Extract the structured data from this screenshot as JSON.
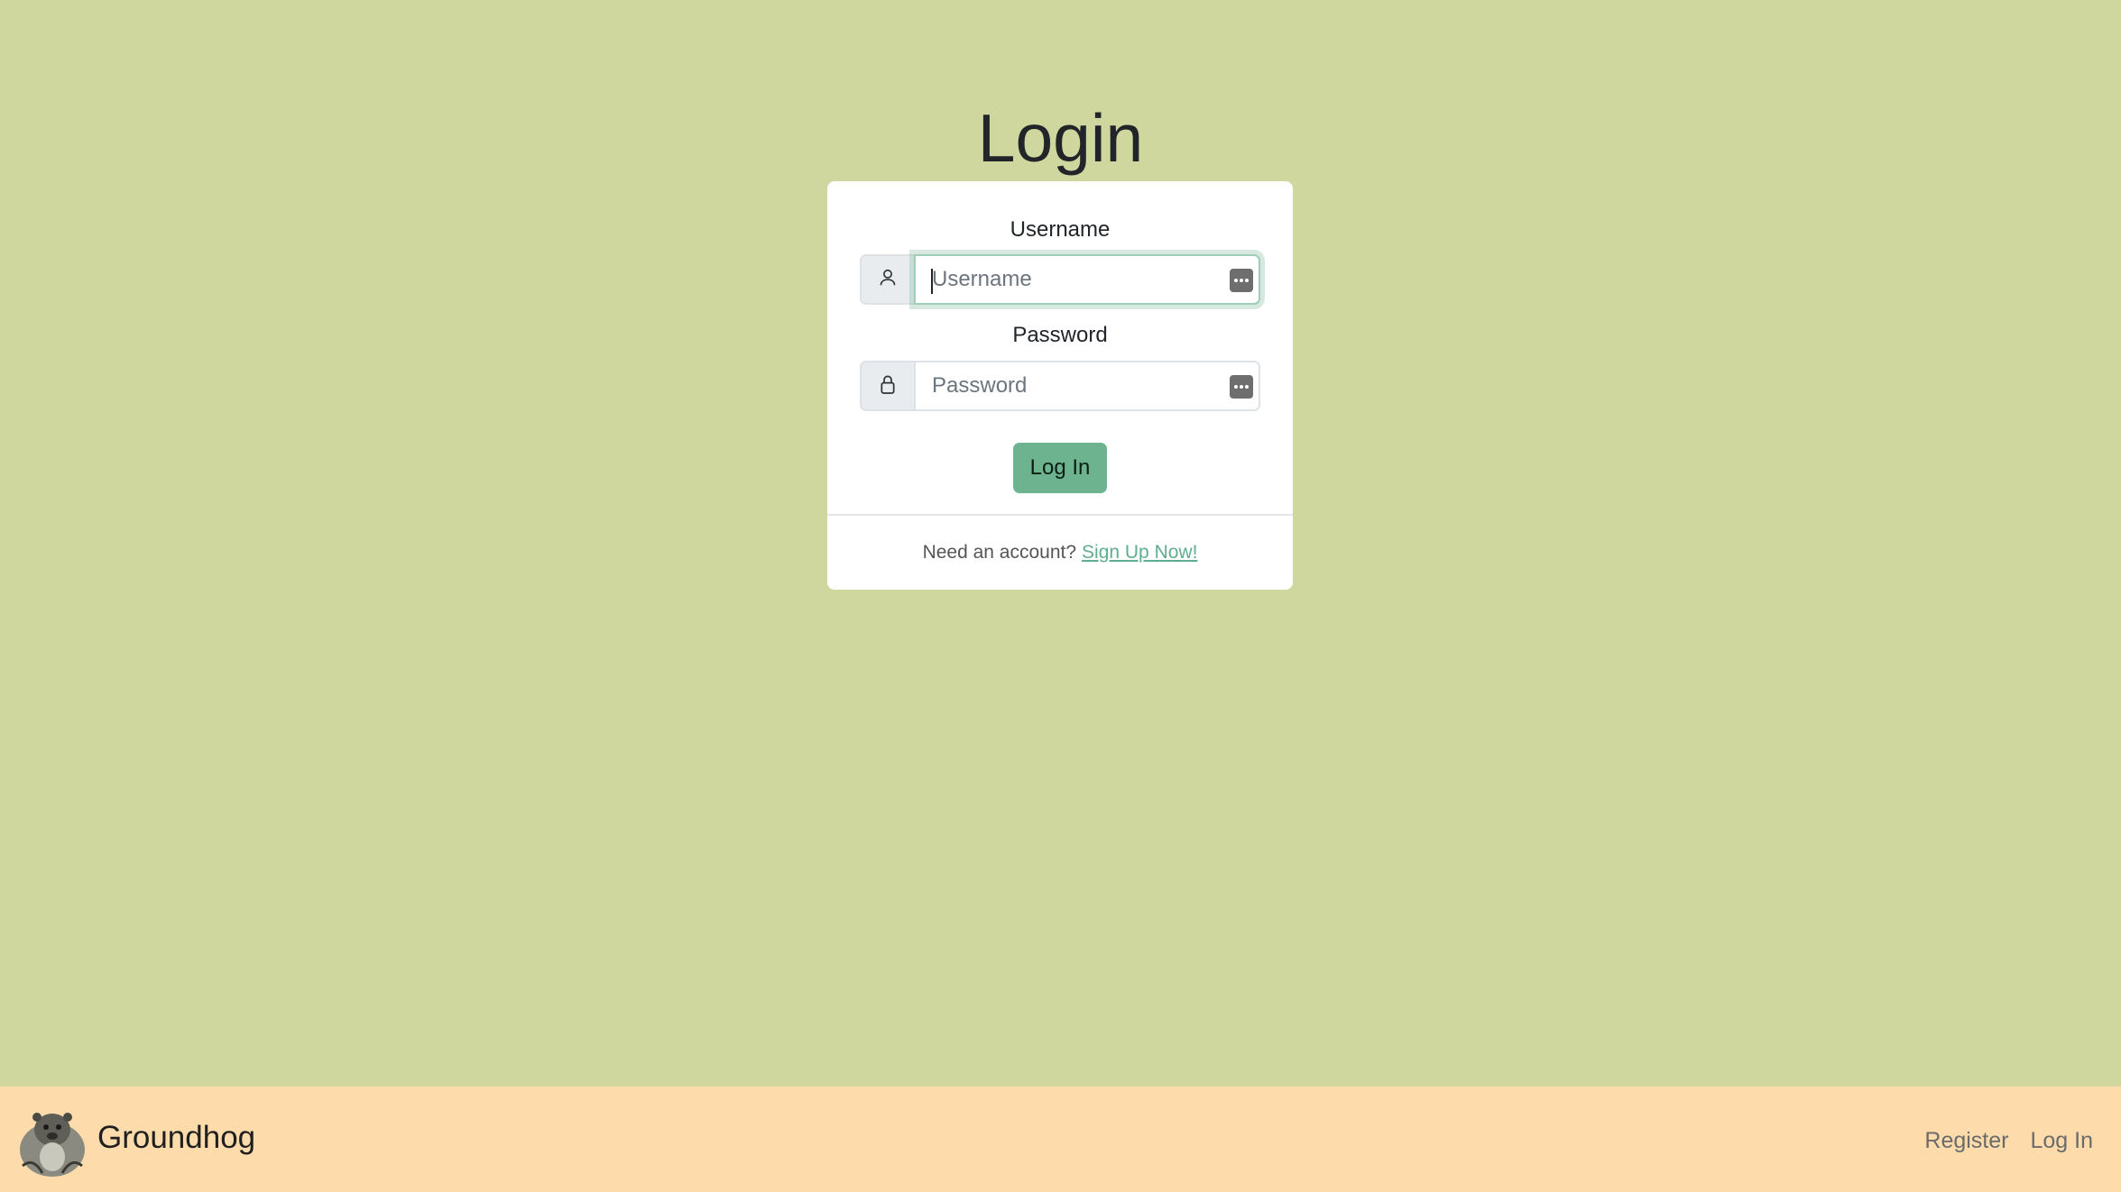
{
  "page": {
    "title": "Login",
    "background": "#CFD79F"
  },
  "form": {
    "username_label": "Username",
    "username_placeholder": "Username",
    "username_value": "",
    "password_label": "Password",
    "password_placeholder": "Password",
    "password_value": "",
    "submit_label": "Log In",
    "username_icon": "user-icon",
    "password_icon": "lock-icon"
  },
  "footer": {
    "prompt": "Need an account?",
    "signup_link": "Sign Up Now!"
  },
  "navbar": {
    "brand": "Groundhog",
    "links": [
      "Register",
      "Log In"
    ],
    "background": "#FDDBAB"
  },
  "colors": {
    "accent": "#6DB38F",
    "link": "#5FAE8F"
  }
}
